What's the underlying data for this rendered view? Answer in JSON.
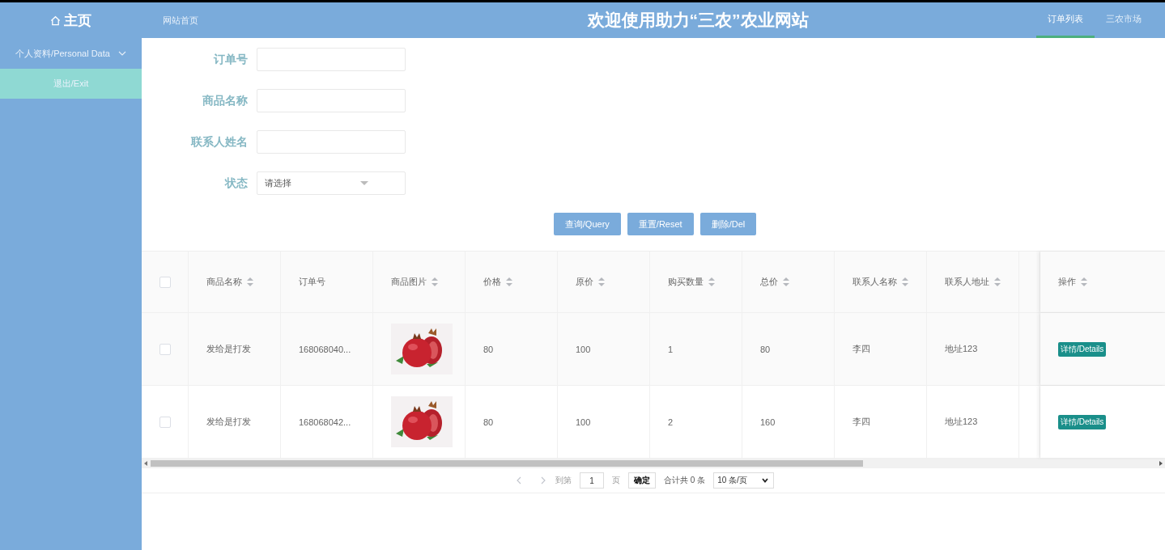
{
  "header": {
    "home_label": "主页",
    "nav_link": "网站首页",
    "title": "欢迎使用助力“三农”农业网站",
    "tabs": [
      {
        "label": "订单列表",
        "selected": true
      },
      {
        "label": "三农市场",
        "selected": false
      }
    ]
  },
  "sidebar": {
    "items": [
      {
        "label": "个人资料/Personal Data",
        "kind": "menu"
      },
      {
        "label": "退出/Exit",
        "kind": "exit"
      }
    ]
  },
  "search_form": {
    "fields": [
      {
        "label": "订单号",
        "kind": "text"
      },
      {
        "label": "商品名称",
        "kind": "text"
      },
      {
        "label": "联系人姓名",
        "kind": "text"
      },
      {
        "label": "状态",
        "kind": "select",
        "placeholder": "请选择"
      }
    ],
    "buttons": [
      "查询/Query",
      "重置/Reset",
      "删除/Del"
    ]
  },
  "table": {
    "select_all_checked": false,
    "columns": [
      {
        "label": "商品名称",
        "sortable": true
      },
      {
        "label": "订单号",
        "sortable": false
      },
      {
        "label": "商品图片",
        "sortable": true
      },
      {
        "label": "价格",
        "sortable": true
      },
      {
        "label": "原价",
        "sortable": true
      },
      {
        "label": "购买数量",
        "sortable": true
      },
      {
        "label": "总价",
        "sortable": true
      },
      {
        "label": "联系人名称",
        "sortable": true
      },
      {
        "label": "联系人地址",
        "sortable": true
      }
    ],
    "action_column": {
      "label": "操作",
      "sortable": true
    },
    "rows": [
      {
        "checked": false,
        "cells": [
          "发给是打发",
          "168068040...",
          {
            "kind": "picture"
          },
          "80",
          "100",
          "1",
          "80",
          "李四",
          "地址123"
        ],
        "action": "详情/Details"
      },
      {
        "checked": false,
        "cells": [
          "发给是打发",
          "168068042...",
          {
            "kind": "picture"
          },
          "80",
          "100",
          "2",
          "160",
          "李四",
          "地址123"
        ],
        "action": "详情/Details"
      }
    ]
  },
  "pagination": {
    "goto_label": "到第",
    "page": "1",
    "page_unit": "页",
    "confirm": "确定",
    "total": "合计共 0 条",
    "page_size": "10 条/页"
  }
}
